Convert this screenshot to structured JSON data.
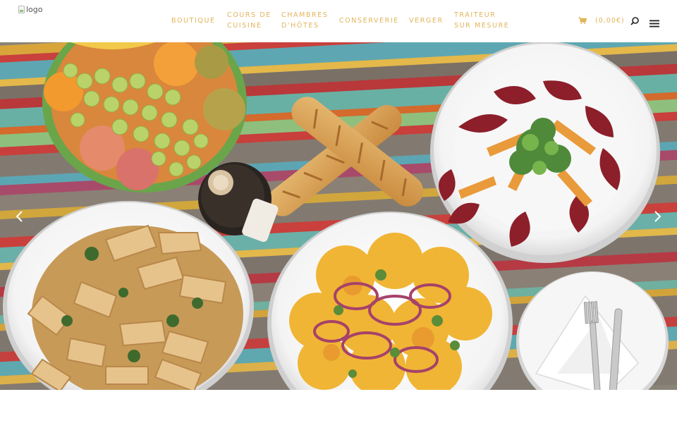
{
  "logo": {
    "alt_text": "logo"
  },
  "nav": {
    "items": [
      {
        "line1": "BOUTIQUE",
        "line2": ""
      },
      {
        "line1": "COURS DE",
        "line2": "CUISINE"
      },
      {
        "line1": "CHAMBRES",
        "line2": "D'HÔTES"
      },
      {
        "line1": "CONSERVERIE",
        "line2": ""
      },
      {
        "line1": "VERGER",
        "line2": ""
      },
      {
        "line1": "TRAITEUR",
        "line2": "SUR MESURE"
      }
    ]
  },
  "cart": {
    "total": "(0,00€)",
    "icon": "cart-icon"
  },
  "icons": {
    "search": "search-icon",
    "menu": "hamburger-menu-icon",
    "prev": "chevron-left-icon",
    "next": "chevron-right-icon"
  },
  "colors": {
    "accent": "#e2b45a",
    "header_bg": "#ffffff",
    "icon_dark": "#222222"
  }
}
